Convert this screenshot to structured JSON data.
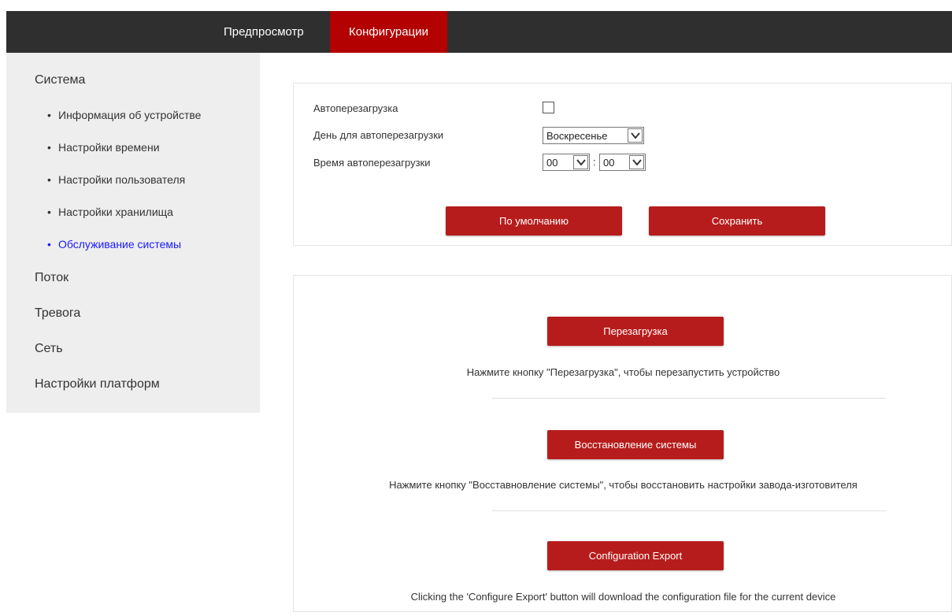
{
  "topnav": {
    "preview": "Предпросмотр",
    "config": "Конфигурации"
  },
  "sidebar": {
    "system": "Система",
    "system_items": [
      "Информация об устройстве",
      "Настройки времени",
      "Настройки пользователя",
      "Настройки хранилища",
      "Обслуживание системы"
    ],
    "stream": "Поток",
    "alarm": "Тревога",
    "network": "Сеть",
    "platform": "Настройки платформ",
    "bullet": "•"
  },
  "autoreboot": {
    "enable_label": "Автоперезагрузка",
    "enabled": false,
    "day_label": "День для автоперезагрузки",
    "day_value": "Воскресенье",
    "time_label": "Время автоперезагрузки",
    "hour_value": "00",
    "minute_value": "00",
    "time_separator": ":",
    "default_button": "По умолчанию",
    "save_button": "Сохранить"
  },
  "maintenance": {
    "reboot_button": "Перезагрузка",
    "reboot_hint": "Нажмите кнопку \"Перезагрузка\", чтобы перезапустить устройство",
    "restore_button": "Восстановление системы",
    "restore_hint": "Нажмите кнопку \"Восставновление системы\", чтобы восстановить настройки завода-изготовителя",
    "export_button": "Configuration Export",
    "export_hint": "Clicking the 'Configure Export' button will download the configuration file for the current device"
  },
  "colors": {
    "topbar": "#2f2f2f",
    "active_tab": "#b30000",
    "button": "#b71c1c",
    "sidebar_bg": "#eeeeee",
    "active_link": "#1a1aff"
  },
  "icons": {
    "select_arrow": "chevron-down-icon"
  }
}
